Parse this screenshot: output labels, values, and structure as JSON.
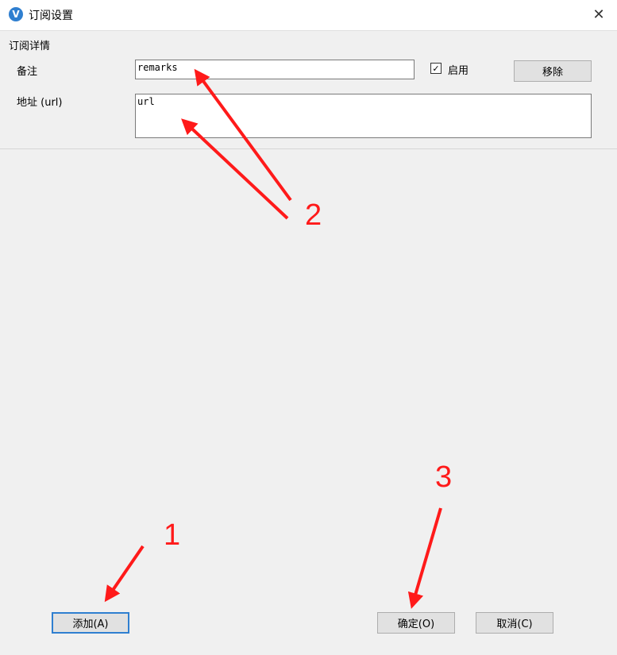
{
  "window": {
    "title": "订阅设置",
    "app_icon_glyph": "V",
    "close_glyph": "✕"
  },
  "group": {
    "title": "订阅详情"
  },
  "fields": {
    "remarks": {
      "label": "备注",
      "value": "remarks"
    },
    "url": {
      "label": "地址 (url)",
      "value": "url"
    }
  },
  "enable": {
    "label": "启用",
    "checked": true,
    "check_glyph": "✓"
  },
  "buttons": {
    "remove": "移除",
    "add": "添加(A)",
    "ok": "确定(O)",
    "cancel": "取消(C)"
  },
  "annotations": {
    "marker_1": "1",
    "marker_2": "2",
    "marker_3": "3",
    "color": "#ff1a1a"
  }
}
